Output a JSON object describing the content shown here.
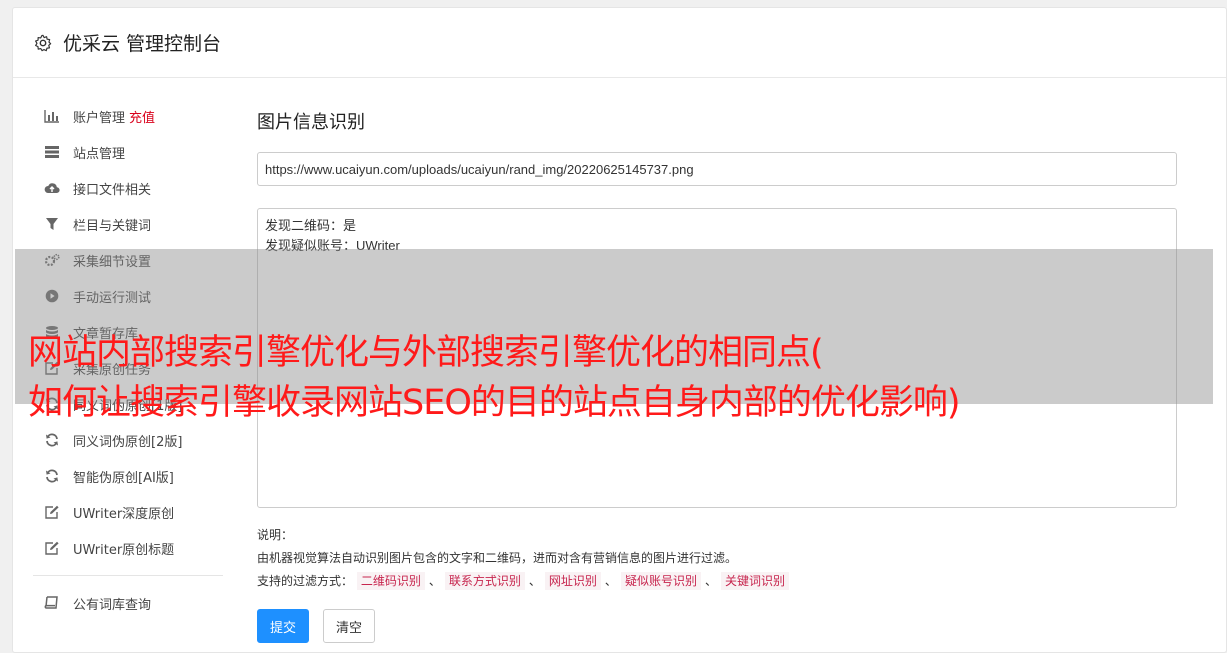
{
  "header": {
    "title": "优采云 管理控制台",
    "icon": "gear-icon"
  },
  "sidebar": {
    "items": [
      {
        "icon": "bar-chart-icon",
        "label": "账户管理",
        "extra": "充值"
      },
      {
        "icon": "server-icon",
        "label": "站点管理"
      },
      {
        "icon": "cloud-upload-icon",
        "label": "接口文件相关"
      },
      {
        "icon": "filter-icon",
        "label": "栏目与关键词"
      },
      {
        "icon": "gears-icon",
        "label": "采集细节设置"
      },
      {
        "icon": "play-circle-icon",
        "label": "手动运行测试"
      },
      {
        "icon": "database-icon",
        "label": "文章暂存库"
      },
      {
        "icon": "edit-icon",
        "label": "采集原创任务"
      },
      {
        "icon": "refresh-icon",
        "label": "同义词伪原创[1版]"
      },
      {
        "icon": "refresh-icon",
        "label": "同义词伪原创[2版]"
      },
      {
        "icon": "refresh-icon",
        "label": "智能伪原创[AI版]"
      },
      {
        "icon": "edit-icon",
        "label": "UWriter深度原创"
      },
      {
        "icon": "edit-icon",
        "label": "UWriter原创标题"
      }
    ],
    "bottom_items": [
      {
        "icon": "book-icon",
        "label": "公有词库查询"
      }
    ]
  },
  "main": {
    "title": "图片信息识别",
    "url_value": "https://www.ucaiyun.com/uploads/ucaiyun/rand_img/20220625145737.png",
    "result_text": "发现二维码：是\n发现疑似账号：UWriter",
    "desc_label": "说明：",
    "desc_text": "由机器视觉算法自动识别图片包含的文字和二维码，进而对含有营销信息的图片进行过滤。",
    "filter_label": "支持的过滤方式：",
    "filters": [
      "二维码识别",
      "联系方式识别",
      "网址识别",
      "疑似账号识别",
      "关键词识别"
    ],
    "filter_sep": "、",
    "submit_label": "提交",
    "clear_label": "清空"
  },
  "overlay": {
    "line1": "网站内部搜索引擎优化与外部搜索引擎优化的相同点(",
    "line2": "如何让搜索引擎收录网站SEO的目的站点自身内部的优化影响)"
  },
  "colors": {
    "primary": "#1e90ff",
    "accent_red": "#d9001b",
    "overlay_text": "#ff1a1a",
    "tag_bg": "#f9f2f4",
    "tag_text": "#c7254e"
  }
}
